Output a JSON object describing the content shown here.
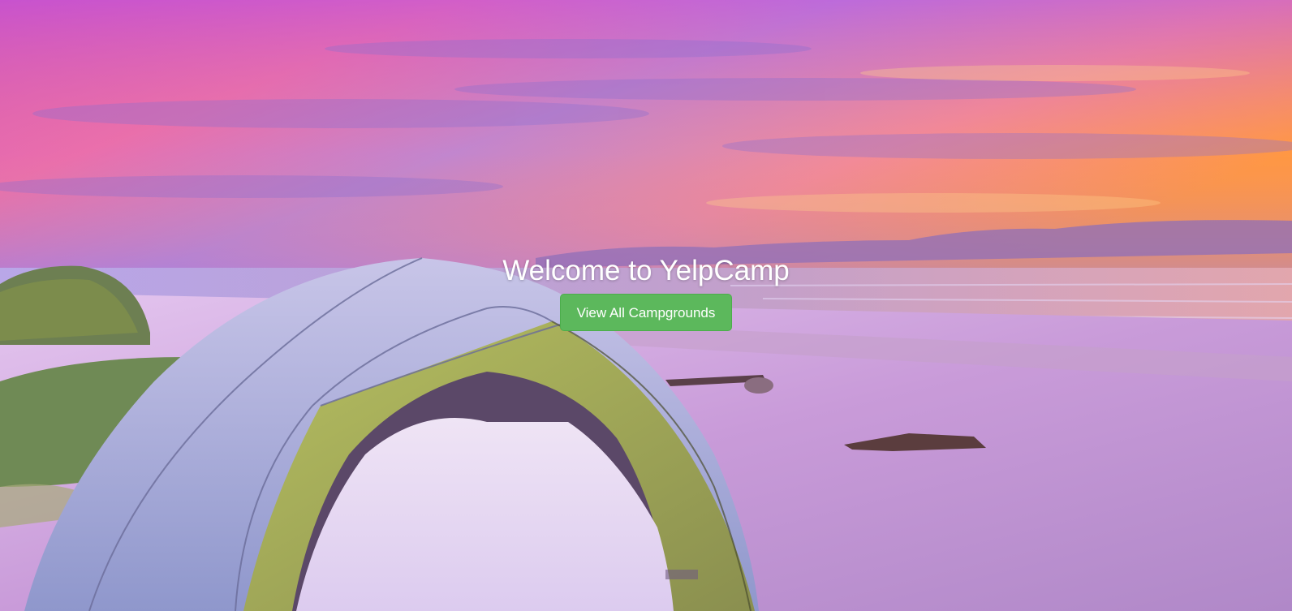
{
  "hero": {
    "title": "Welcome to YelpCamp",
    "cta_label": "View All Campgrounds",
    "background_image": "sunset-beach-tent-photo"
  },
  "colors": {
    "button_bg": "#5cb85c",
    "title_text": "#ffffff"
  }
}
